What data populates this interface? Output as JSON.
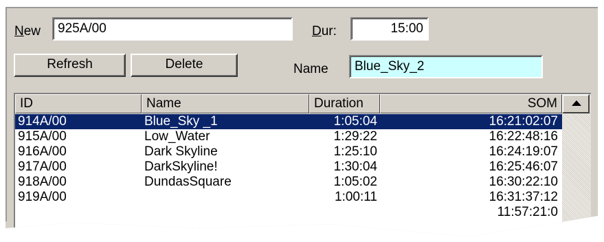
{
  "form": {
    "new_label_mnemonic": "N",
    "new_label_rest": "ew",
    "new_value": "925A/00",
    "dur_label_mnemonic": "D",
    "dur_label_rest": "ur:",
    "dur_value": "15:00",
    "name_label": "Name",
    "name_value": "Blue_Sky_2",
    "name_field_color": "#ccffff"
  },
  "buttons": {
    "refresh": "Refresh",
    "delete": "Delete"
  },
  "table": {
    "columns": [
      "ID",
      "Name",
      "Duration",
      "SOM"
    ],
    "rows": [
      {
        "id": "914A/00",
        "name": "Blue_Sky _1",
        "duration": "1:05:04",
        "som": "16:21:02:07",
        "selected": true
      },
      {
        "id": "915A/00",
        "name": "Low_Water",
        "duration": "1:29:22",
        "som": "16:22:48:16"
      },
      {
        "id": "916A/00",
        "name": "Dark Skyline",
        "duration": "1:25:10",
        "som": "16:24:19:07"
      },
      {
        "id": "917A/00",
        "name": "DarkSkyline!",
        "duration": "1:30:04",
        "som": "16:25:46:07"
      },
      {
        "id": "918A/00",
        "name": "DundasSquare",
        "duration": "1:05:02",
        "som": "16:30:22:10"
      },
      {
        "id": "919A/00",
        "name": "",
        "duration": "1:00:11",
        "som": "16:31:37:12"
      },
      {
        "id": "",
        "name": "",
        "duration": "",
        "som": "11:57:21:0"
      }
    ]
  },
  "colors": {
    "selection": "#0a246a",
    "panel": "#d4d0c8"
  },
  "icons": {
    "scroll_up": "triangle-up"
  }
}
